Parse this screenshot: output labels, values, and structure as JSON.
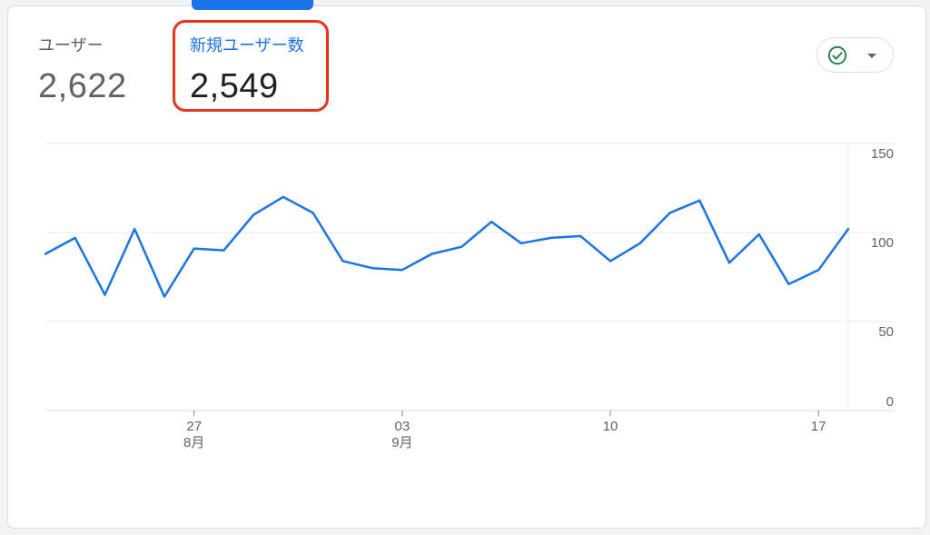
{
  "metrics": [
    {
      "label": "ユーザー",
      "value": "2,622"
    },
    {
      "label": "新規ユーザー数",
      "value": "2,549"
    }
  ],
  "status": {
    "icon": "check-circle-icon",
    "dropdown_icon": "caret-down-icon",
    "color": "#188038"
  },
  "colors": {
    "accent": "#1a73e8",
    "highlight": "#e8341c",
    "line": "#1a73e8"
  },
  "chart_data": {
    "type": "line",
    "title": "",
    "xlabel": "",
    "ylabel": "",
    "ylim": [
      0,
      150
    ],
    "y_ticks": [
      "150",
      "100",
      "50",
      "0"
    ],
    "y_axis_position": "right",
    "grid": true,
    "x_ticks": [
      {
        "label": "27",
        "sublabel": "8月",
        "date": "08-27"
      },
      {
        "label": "03",
        "sublabel": "9月",
        "date": "09-03"
      },
      {
        "label": "10",
        "sublabel": "",
        "date": "09-10"
      },
      {
        "label": "17",
        "sublabel": "",
        "date": "09-17"
      }
    ],
    "x": [
      "08-22",
      "08-23",
      "08-24",
      "08-25",
      "08-26",
      "08-27",
      "08-28",
      "08-29",
      "08-30",
      "08-31",
      "09-01",
      "09-02",
      "09-03",
      "09-04",
      "09-05",
      "09-06",
      "09-07",
      "09-08",
      "09-09",
      "09-10",
      "09-11",
      "09-12",
      "09-13",
      "09-14",
      "09-15",
      "09-16",
      "09-17",
      "09-18"
    ],
    "series": [
      {
        "values": [
          88,
          97,
          65,
          102,
          64,
          91,
          90,
          110,
          120,
          111,
          84,
          80,
          79,
          88,
          92,
          106,
          94,
          97,
          98,
          84,
          94,
          111,
          118,
          83,
          99,
          71,
          79,
          102
        ]
      }
    ]
  }
}
